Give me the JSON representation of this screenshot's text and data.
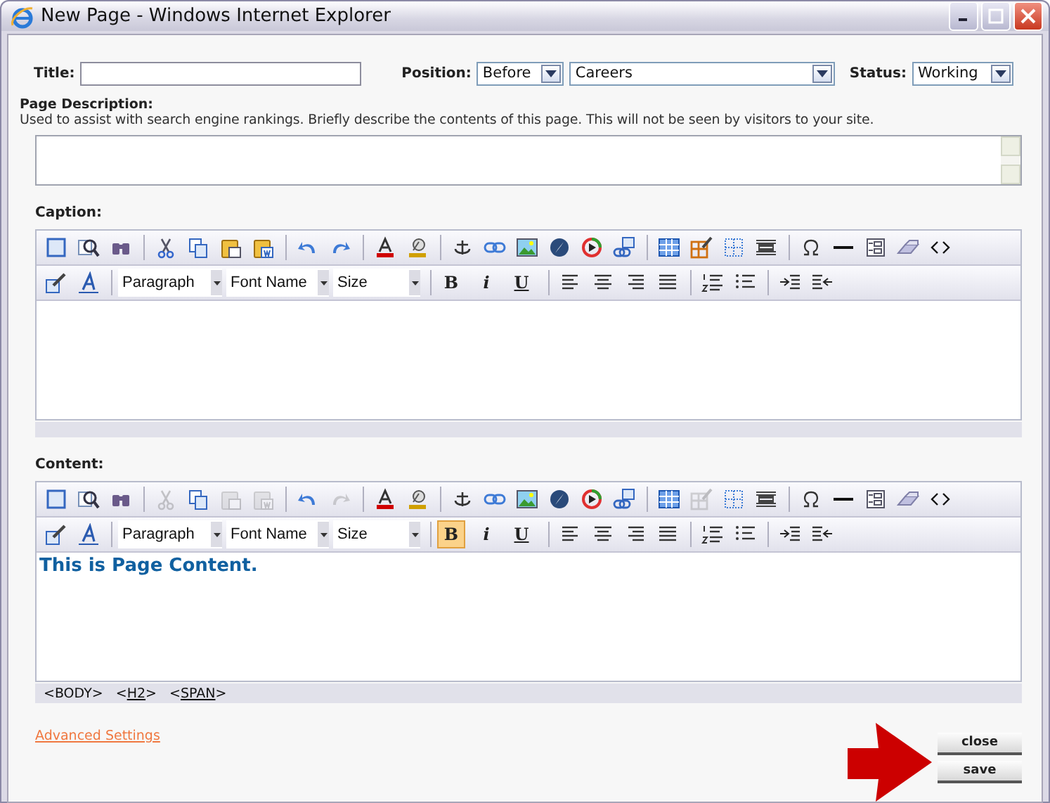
{
  "window": {
    "title": "New Page - Windows Internet Explorer"
  },
  "form": {
    "title_label": "Title:",
    "position_label": "Position:",
    "position": "Before",
    "page": "Careers",
    "status_label": "Status:",
    "status": "Working"
  },
  "page_description": {
    "label": "Page Description:",
    "hint": "Used to assist with search engine rankings. Briefly describe the contents of this page. This will not be seen by visitors to your site."
  },
  "editors": [
    {
      "label": "Caption:",
      "tools": [
        {
          "disabled": false
        },
        {
          "disabled": false
        },
        {
          "disabled": false
        },
        {
          "disabled": false
        },
        {
          "disabled": false
        },
        {
          "disabled": false
        },
        {
          "disabled": false
        },
        {
          "disabled": false
        },
        {
          "disabled": false
        },
        {
          "disabled": false
        },
        {
          "disabled": false
        },
        {
          "disabled": false
        },
        {
          "disabled": false
        },
        {
          "disabled": false
        },
        {
          "disabled": false
        },
        {
          "disabled": false
        },
        {
          "disabled": false
        },
        {
          "disabled": false
        },
        {
          "disabled": false
        },
        {
          "disabled": false
        },
        {
          "disabled": false
        },
        {
          "disabled": false
        },
        {
          "disabled": false
        },
        {
          "disabled": false
        },
        {
          "disabled": false
        },
        {
          "disabled": false
        }
      ],
      "dropdowns": [
        "Paragraph",
        "Font Name",
        "Size"
      ],
      "format_buttons": [
        {
          "text": "B",
          "selected": false
        },
        {
          "text": "i",
          "selected": false
        },
        {
          "text": "U",
          "selected": false
        }
      ]
    },
    {
      "label": "Content:",
      "tools": [
        {
          "disabled": false
        },
        {
          "disabled": false
        },
        {
          "disabled": false
        },
        {
          "disabled": true
        },
        {
          "disabled": false
        },
        {
          "disabled": true
        },
        {
          "disabled": true
        },
        {
          "disabled": false
        },
        {
          "disabled": true
        },
        {
          "disabled": false
        },
        {
          "disabled": false
        },
        {
          "disabled": false
        },
        {
          "disabled": false
        },
        {
          "disabled": false
        },
        {
          "disabled": false
        },
        {
          "disabled": false
        },
        {
          "disabled": false
        },
        {
          "disabled": false
        },
        {
          "disabled": true
        },
        {
          "disabled": false
        },
        {
          "disabled": false
        },
        {
          "disabled": false
        },
        {
          "disabled": false
        },
        {
          "disabled": false
        },
        {
          "disabled": false
        },
        {
          "disabled": false
        }
      ],
      "dropdowns": [
        "Paragraph",
        "Font Name",
        "Size"
      ],
      "format_buttons": [
        {
          "text": "B",
          "selected": true
        },
        {
          "text": "i",
          "selected": false
        },
        {
          "text": "U",
          "selected": false
        }
      ],
      "content": "This is Page Content.",
      "path": [
        {
          "text": "<BODY>",
          "link": false
        },
        {
          "text": "<H2>",
          "link": true
        },
        {
          "text": "<SPAN>",
          "link": true
        }
      ]
    }
  ],
  "advanced_link": "Advanced Settings",
  "buttons": [
    "close",
    "save"
  ]
}
